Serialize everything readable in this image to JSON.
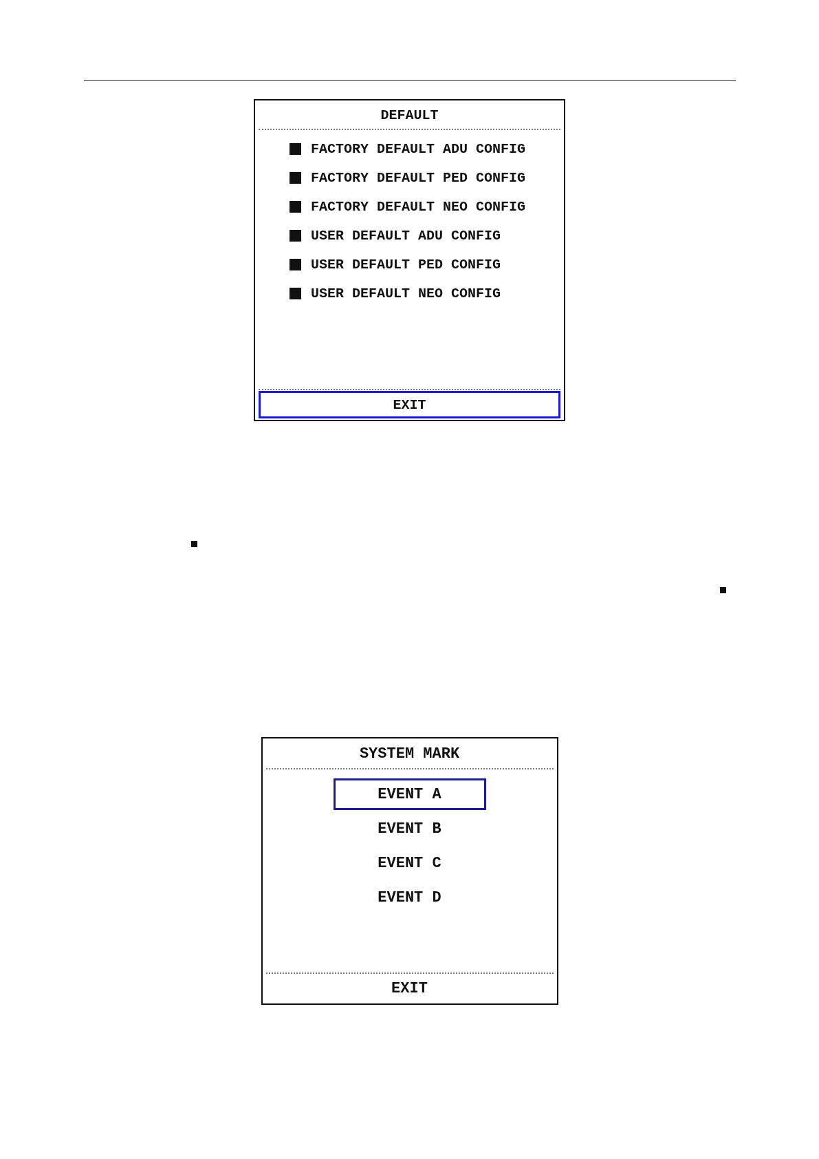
{
  "default_dialog": {
    "title": "DEFAULT",
    "items": [
      {
        "label": "FACTORY DEFAULT ADU CONFIG"
      },
      {
        "label": "FACTORY DEFAULT PED CONFIG"
      },
      {
        "label": "FACTORY DEFAULT NEO CONFIG"
      },
      {
        "label": "USER DEFAULT ADU CONFIG"
      },
      {
        "label": "USER DEFAULT PED CONFIG"
      },
      {
        "label": "USER DEFAULT NEO CONFIG"
      }
    ],
    "exit": {
      "label": "EXIT",
      "selected": true
    }
  },
  "system_mark_dialog": {
    "title": "SYSTEM MARK",
    "items": [
      {
        "label": "EVENT A",
        "selected": true
      },
      {
        "label": "EVENT B",
        "selected": false
      },
      {
        "label": "EVENT C",
        "selected": false
      },
      {
        "label": "EVENT D",
        "selected": false
      }
    ],
    "exit": {
      "label": "EXIT",
      "selected": false
    }
  }
}
